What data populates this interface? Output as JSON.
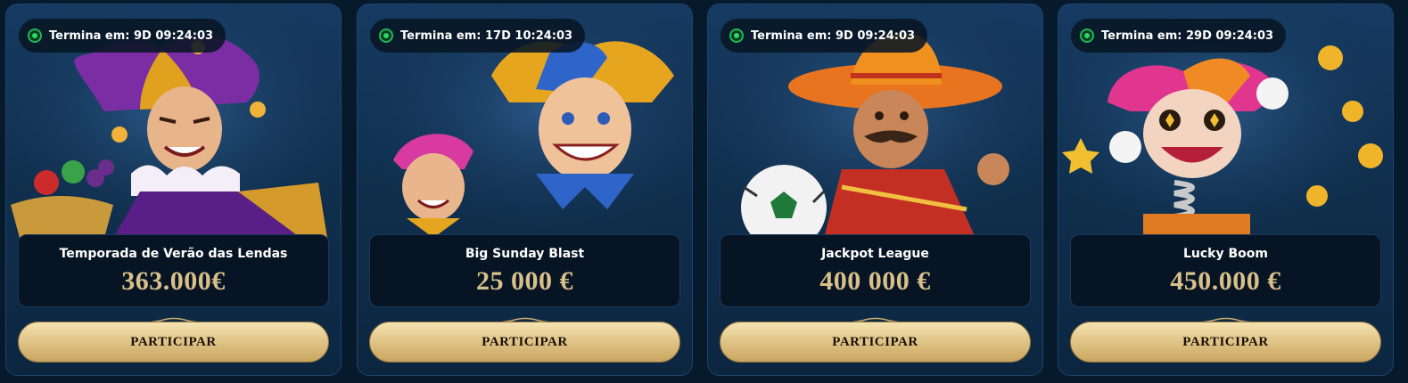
{
  "cards": [
    {
      "timer": "Termina em: 9D 09:24:03",
      "name": "Temporada de Verão das Lendas",
      "prize": "363.000€",
      "button": "PARTICIPAR",
      "art": "jester-with-fruit"
    },
    {
      "timer": "Termina em: 17D 10:24:03",
      "name": "Big Sunday Blast",
      "prize": "25 000 €",
      "button": "PARTICIPAR",
      "art": "two-jesters"
    },
    {
      "timer": "Termina em: 9D 09:24:03",
      "name": "Jackpot League",
      "prize": "400 000 €",
      "button": "PARTICIPAR",
      "art": "mariachi-with-football"
    },
    {
      "timer": "Termina em: 29D 09:24:03",
      "name": "Lucky Boom",
      "prize": "450.000 €",
      "button": "PARTICIPAR",
      "art": "jack-in-the-box-jester"
    }
  ],
  "colors": {
    "page_bg": "#071a2c",
    "card_bg": "#12355a",
    "prize_gold": "#d9c08a",
    "button_gold": "#e2c68a",
    "live_green": "#2bd96b"
  }
}
